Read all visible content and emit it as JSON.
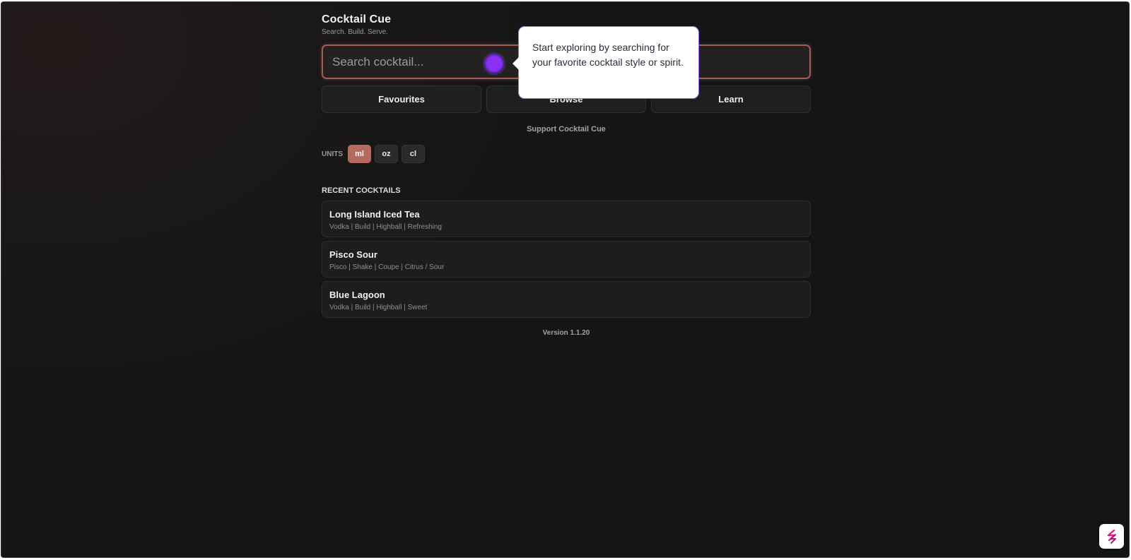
{
  "app": {
    "title": "Cocktail Cue",
    "subtitle": "Search. Build. Serve."
  },
  "search": {
    "placeholder": "Search cocktail...",
    "value": ""
  },
  "nav": {
    "items": [
      {
        "label": "Favourites"
      },
      {
        "label": "Browse"
      },
      {
        "label": "Learn"
      }
    ]
  },
  "support": {
    "label": "Support Cocktail Cue"
  },
  "units": {
    "label": "UNITS",
    "options": [
      {
        "label": "ml",
        "selected": true
      },
      {
        "label": "oz",
        "selected": false
      },
      {
        "label": "cl",
        "selected": false
      }
    ]
  },
  "recent": {
    "heading": "RECENT COCKTAILS",
    "items": [
      {
        "name": "Long Island Iced Tea",
        "meta": "Vodka | Build | Highball | Refreshing"
      },
      {
        "name": "Pisco Sour",
        "meta": "Pisco | Shake | Coupe | Citrus / Sour"
      },
      {
        "name": "Blue Lagoon",
        "meta": "Vodka | Build | Highball | Sweet"
      }
    ]
  },
  "footer": {
    "version": "Version 1.1.20"
  },
  "tour": {
    "tooltip_text": "Start exploring by searching for your favorite cocktail style or spirit.",
    "hotspot_icon": "pulse-dot-icon"
  },
  "widget": {
    "icon": "supademo-logo-icon"
  },
  "colors": {
    "background": "#151516",
    "accent": "#b46a5e",
    "tour_purple": "#8b2ff0"
  }
}
